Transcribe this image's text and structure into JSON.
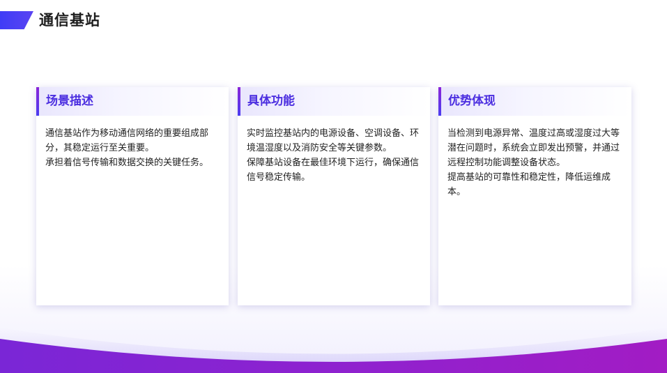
{
  "page": {
    "title": "通信基站"
  },
  "cards": [
    {
      "title": "场景描述",
      "paragraphs": [
        "通信基站作为移动通信网络的重要组成部分，其稳定运行至关重要。",
        "承担着信号传输和数据交换的关键任务。"
      ]
    },
    {
      "title": "具体功能",
      "paragraphs": [
        "实时监控基站内的电源设备、空调设备、环境温湿度以及消防安全等关键参数。",
        "保障基站设备在最佳环境下运行，确保通信信号稳定传输。"
      ]
    },
    {
      "title": "优势体现",
      "paragraphs": [
        "当检测到电源异常、温度过高或湿度过大等潜在问题时，系统会立即发出预警，并通过远程控制功能调整设备状态。",
        "提高基站的可靠性和稳定性，降低运维成本。"
      ]
    }
  ],
  "colors": {
    "accent": "#4b2ee0",
    "title_shape": "#3f3cf6",
    "wave_start": "#7a26d6",
    "wave_end": "#a21cc4"
  }
}
